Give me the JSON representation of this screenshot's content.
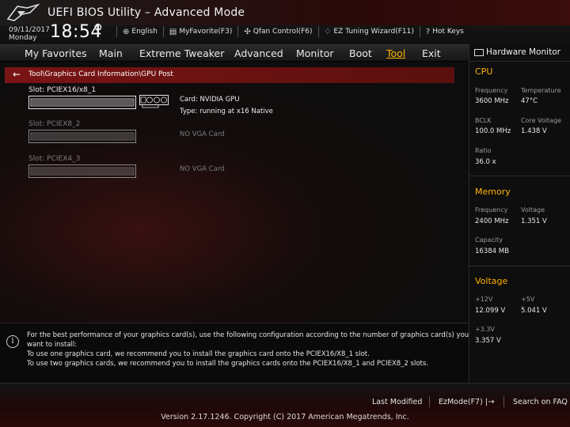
{
  "app": {
    "title": "UEFI BIOS Utility – Advanced Mode"
  },
  "header": {
    "date": "09/11/2017",
    "day": "Monday",
    "time": "18:54",
    "toolbar": [
      {
        "icon": "globe-icon",
        "label": "English"
      },
      {
        "icon": "my-favorite-icon",
        "label": "MyFavorite(F3)"
      },
      {
        "icon": "fan-icon",
        "label": "Qfan Control(F6)"
      },
      {
        "icon": "ez-tuning-icon",
        "label": "EZ Tuning Wizard(F11)"
      },
      {
        "icon": "hotkeys-icon",
        "label": "Hot Keys"
      }
    ]
  },
  "menu": {
    "items": [
      "My Favorites",
      "Main",
      "Extreme Tweaker",
      "Advanced",
      "Monitor",
      "Boot",
      "Tool",
      "Exit"
    ],
    "active": "Tool"
  },
  "breadcrumb": {
    "path": "Tool\\Graphics Card Information\\GPU Post"
  },
  "slots": [
    {
      "label": "Slot: PCIEX16/x8_1",
      "card_line": "Card: NVIDIA GPU",
      "type_line": "Type: running at x16 Native",
      "active": true
    },
    {
      "label": "Slot: PCIEX8_2",
      "card_line": "NO VGA Card",
      "active": false
    },
    {
      "label": "Slot: PCIEX4_3",
      "card_line": "NO VGA Card",
      "active": false
    }
  ],
  "info": {
    "lines": [
      "For the best performance of your graphics card(s), use the following configuration according to the number of graphics card(s) you",
      "want to install:",
      "To use one graphics card, we recommend you to install  the graphics card onto the PCIEX16/X8_1 slot.",
      "To use two graphics cards, we recommend you to install the graphics cards onto the PCIEX16/X8_1 and PCIEX8_2 slots."
    ]
  },
  "hardware_monitor": {
    "title": "Hardware Monitor",
    "cpu": {
      "heading": "CPU",
      "frequency_label": "Frequency",
      "frequency": "3600 MHz",
      "temperature_label": "Temperature",
      "temperature": "47°C",
      "bclk_label": "BCLK",
      "bclk": "100.0 MHz",
      "core_voltage_label": "Core Voltage",
      "core_voltage": "1.438 V",
      "ratio_label": "Ratio",
      "ratio": "36.0 x"
    },
    "memory": {
      "heading": "Memory",
      "frequency_label": "Frequency",
      "frequency": "2400 MHz",
      "voltage_label": "Voltage",
      "voltage": "1.351 V",
      "capacity_label": "Capacity",
      "capacity": "16384 MB"
    },
    "voltage": {
      "heading": "Voltage",
      "v12_label": "+12V",
      "v12": "12.099 V",
      "v5_label": "+5V",
      "v5": "5.041 V",
      "v33_label": "+3.3V",
      "v33": "3.357 V"
    }
  },
  "footer": {
    "last_modified": "Last Modified",
    "ezmode": "EzMode(F7)",
    "search": "Search on FAQ",
    "copyright": "Version 2.17.1246. Copyright (C) 2017 American Megatrends, Inc."
  },
  "colors": {
    "accent": "#ffb400",
    "breadcrumb": "#7a1414",
    "background": "#0c0c0c"
  }
}
